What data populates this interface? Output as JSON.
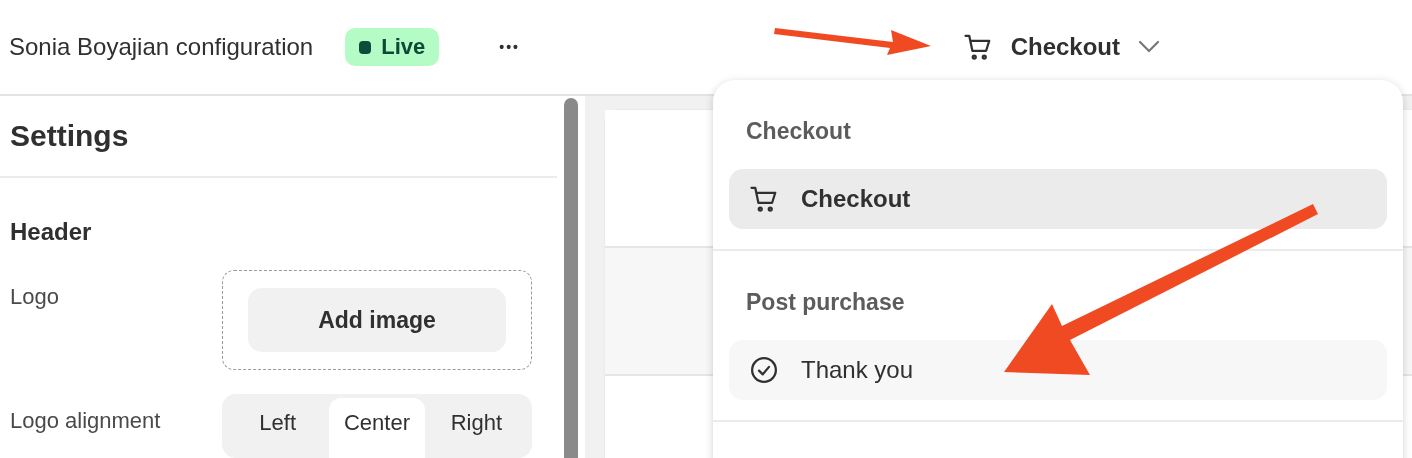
{
  "topbar": {
    "title": "Sonia Boyajian configuration",
    "status": {
      "label": "Live",
      "color": "#0b4d3a"
    },
    "more": "•••",
    "page_selector": {
      "label": "Checkout"
    }
  },
  "settings": {
    "title": "Settings",
    "section": "Header",
    "logo": {
      "label": "Logo",
      "button": "Add image"
    },
    "alignment": {
      "label": "Logo alignment",
      "options": [
        {
          "label": "Left",
          "selected": false
        },
        {
          "label": "Center",
          "selected": true
        },
        {
          "label": "Right",
          "selected": false
        }
      ]
    }
  },
  "dropdown": {
    "groups": [
      {
        "heading": "Checkout",
        "items": [
          {
            "label": "Checkout",
            "kind": "cart",
            "selected": true
          }
        ]
      },
      {
        "heading": "Post purchase",
        "items": [
          {
            "label": "Thank you",
            "kind": "check",
            "selected": false
          }
        ]
      }
    ]
  }
}
